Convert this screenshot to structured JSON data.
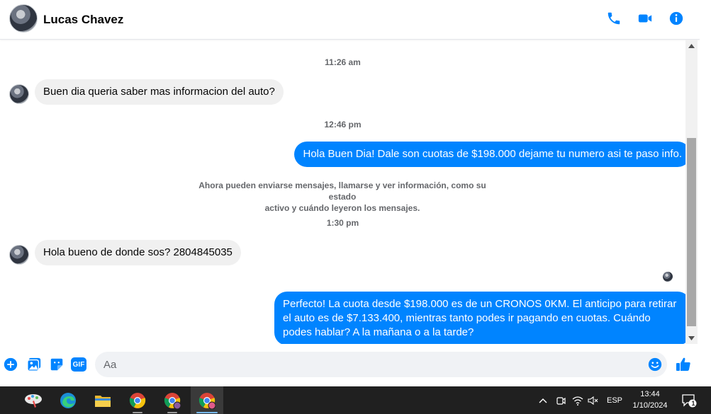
{
  "header": {
    "contact_name": "Lucas Chavez",
    "icons": [
      "phone-icon",
      "video-camera-icon",
      "info-icon"
    ],
    "accent": "#0084ff"
  },
  "conversation": {
    "timestamps": [
      "11:26 am",
      "12:46 pm",
      "1:30 pm"
    ],
    "messages": [
      {
        "from": "contact",
        "text": "Buen dia queria saber mas informacion del auto?"
      },
      {
        "from": "me",
        "text": "Hola Buen Dia! Dale son cuotas de $198.000 dejame tu numero asi te paso info."
      },
      {
        "from": "contact",
        "text": "Hola bueno de donde sos? 2804845035"
      },
      {
        "from": "me",
        "text": "Perfecto! La cuota desde $198.000 es de un CRONOS 0KM. El anticipo para retirar el auto es de $7.133.400, mientras tanto podes ir pagando en cuotas. Cuándo podes hablar? A la mañana o a la tarde?"
      }
    ],
    "notice_line1": "Ahora pueden enviarse mensajes, llamarse y ver información, como su estado",
    "notice_line2": "activo y cuándo leyeron los mensajes."
  },
  "composer": {
    "placeholder": "Aa",
    "icons": [
      "add-icon",
      "photo-icon",
      "sticker-icon",
      "gif-icon",
      "emoji-icon",
      "like-icon"
    ],
    "gif_label": "GIF"
  },
  "taskbar": {
    "apps": [
      "paint-app-icon",
      "edge-icon",
      "file-explorer-icon",
      "chrome-icon",
      "chrome-profile-icon",
      "chrome-active-profile-icon"
    ],
    "language": "ESP",
    "time": "13:44",
    "date": "1/10/2024",
    "notification_count": "1"
  }
}
